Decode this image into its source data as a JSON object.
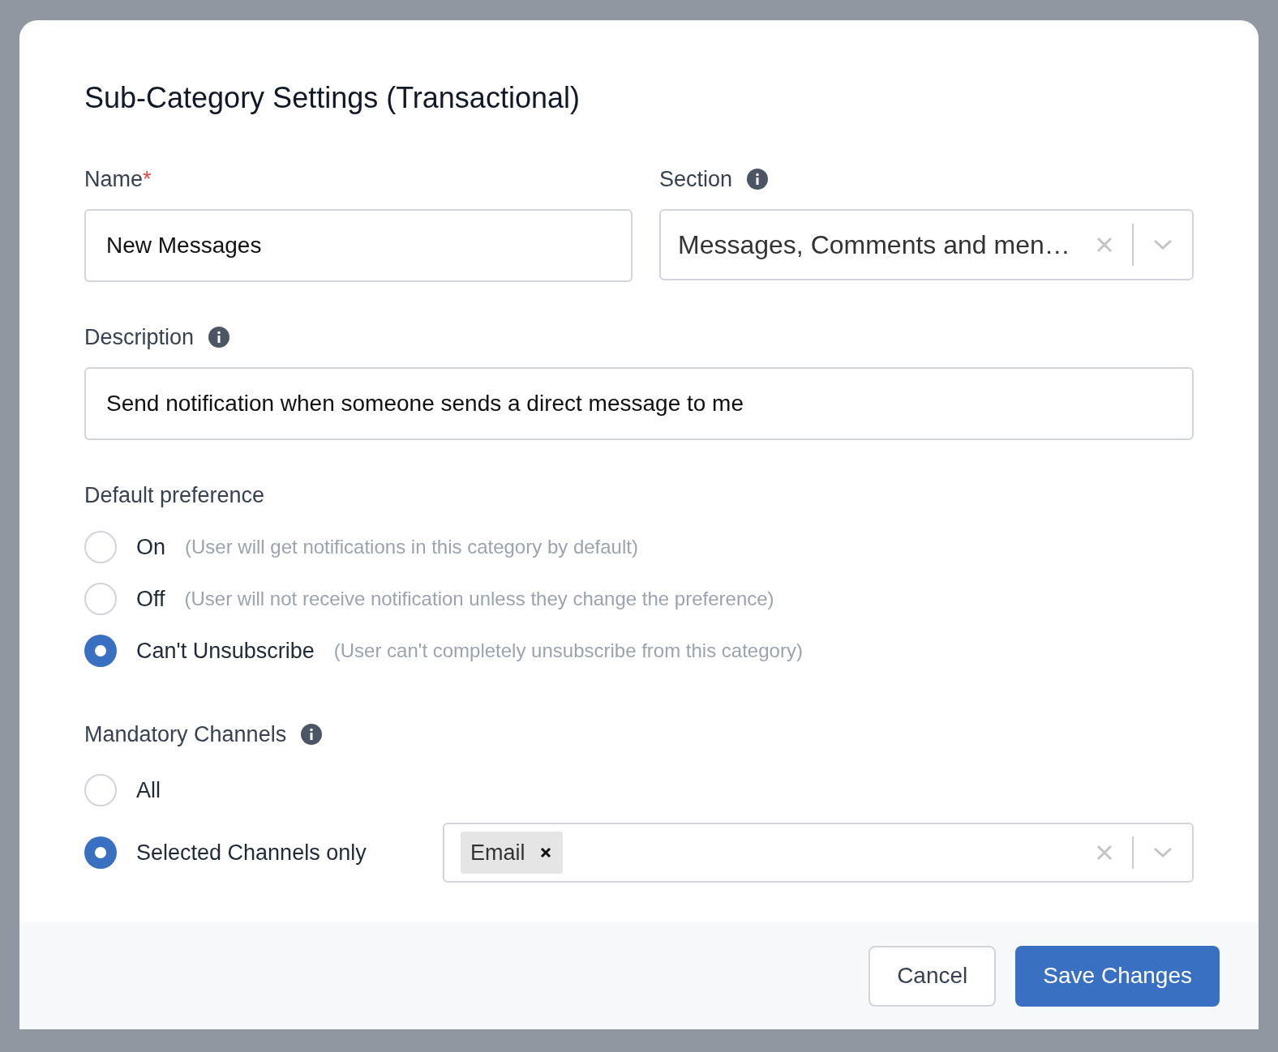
{
  "dialog": {
    "title": "Sub-Category Settings (Transactional)"
  },
  "name_field": {
    "label": "Name",
    "required_mark": "*",
    "value": "New Messages"
  },
  "section_field": {
    "label": "Section",
    "value": "Messages, Comments and men…"
  },
  "description_field": {
    "label": "Description",
    "value": "Send notification when someone sends a direct message to me"
  },
  "default_preference": {
    "label": "Default preference",
    "options": [
      {
        "label": "On",
        "hint": "(User will get notifications in this category by default)",
        "selected": false
      },
      {
        "label": "Off",
        "hint": "(User will not receive notification unless they change the preference)",
        "selected": false
      },
      {
        "label": "Can't Unsubscribe",
        "hint": "(User can't completely unsubscribe from this category)",
        "selected": true
      }
    ]
  },
  "mandatory_channels": {
    "label": "Mandatory Channels",
    "options": [
      {
        "label": "All",
        "selected": false
      },
      {
        "label": "Selected Channels only",
        "selected": true
      }
    ],
    "chips": [
      {
        "label": "Email"
      }
    ]
  },
  "buttons": [
    {
      "label": "Cancel",
      "kind": "secondary"
    },
    {
      "label": "Save Changes",
      "kind": "primary"
    }
  ]
}
